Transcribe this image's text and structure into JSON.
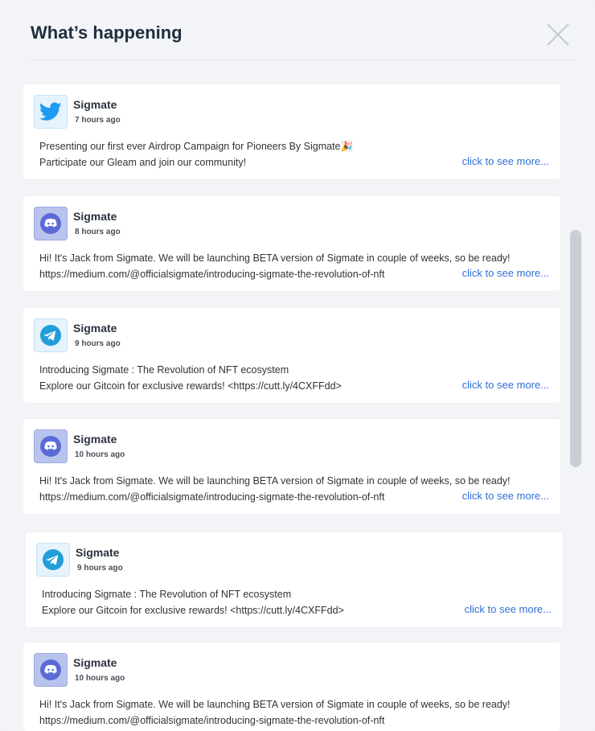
{
  "header": {
    "title": "What’s happening"
  },
  "colors": {
    "link": "#2f6fd6",
    "twitter": "#1d9bf0",
    "discord": "#5865f2",
    "telegram": "#229ed9"
  },
  "posts": [
    {
      "platform_icon": "twitter-icon",
      "author": "Sigmate",
      "time": "7 hours ago",
      "line1": "Presenting our first ever Airdrop Campaign for Pioneers By Sigmate🎉",
      "line2": "Participate our Gleam and join our community!",
      "more_label": "click to see more..."
    },
    {
      "platform_icon": "discord-icon",
      "author": "Sigmate",
      "time": "8 hours ago",
      "line1": "Hi! It's Jack from Sigmate. We will be launching BETA version of Sigmate in couple of weeks, so be ready!",
      "line2": "https://medium.com/@officialsigmate/introducing-sigmate-the-revolution-of-nft",
      "more_label": "click to see more..."
    },
    {
      "platform_icon": "telegram-icon",
      "author": "Sigmate",
      "time": "9 hours ago",
      "line1": "Introducing Sigmate : The Revolution of NFT ecosystem",
      "line2": "Explore our Gitcoin for exclusive rewards! <https://cutt.ly/4CXFFdd>",
      "more_label": "click to see more..."
    },
    {
      "platform_icon": "discord-icon",
      "author": "Sigmate",
      "time": "10 hours ago",
      "line1": "Hi! It's Jack from Sigmate. We will be launching BETA version of Sigmate in couple of weeks, so be ready!",
      "line2": "https://medium.com/@officialsigmate/introducing-sigmate-the-revolution-of-nft",
      "more_label": "click to see more..."
    },
    {
      "platform_icon": "telegram-icon",
      "author": "Sigmate",
      "time": "9 hours ago",
      "line1": "Introducing Sigmate : The Revolution of NFT ecosystem",
      "line2": "Explore our Gitcoin for exclusive rewards! <https://cutt.ly/4CXFFdd>",
      "more_label": "click to see more..."
    },
    {
      "platform_icon": "discord-icon",
      "author": "Sigmate",
      "time": "10 hours ago",
      "line1": "Hi! It's Jack from Sigmate. We will be launching BETA version of Sigmate in couple of weeks, so be ready!",
      "line2": "https://medium.com/@officialsigmate/introducing-sigmate-the-revolution-of-nft"
    }
  ]
}
